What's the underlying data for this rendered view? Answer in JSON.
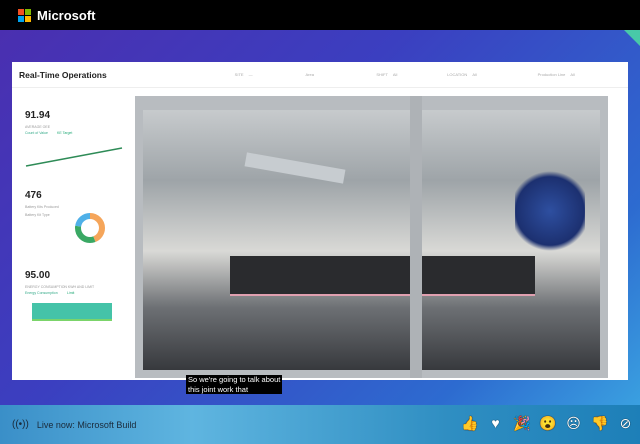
{
  "brand": "Microsoft",
  "dashboard": {
    "title": "Real-Time Operations",
    "filters": [
      {
        "label": "SITE",
        "value": "—"
      },
      {
        "label": "Area",
        "value": ""
      },
      {
        "label": "SHIFT",
        "value": "All"
      },
      {
        "label": "LOCATION",
        "value": "All"
      },
      {
        "label": "Production Line",
        "value": "All"
      }
    ],
    "kpi1": {
      "value": "91.94",
      "label": "AVERAGE OEE",
      "legend": [
        "Count of Value",
        "KE Target"
      ]
    },
    "kpi2": {
      "value": "476",
      "label": "Battery Kits Produced",
      "legend_title": "Battery Kit Type"
    },
    "kpi3": {
      "value": "95.00",
      "label": "ENERGY CONSUMPTION KWH AND LIMIT",
      "legend": [
        "Energy Consumption",
        "Limit"
      ]
    }
  },
  "caption": [
    "So we're going to talk about",
    "this joint work that"
  ],
  "bottom": {
    "live_label": "Live now:",
    "event": "Microsoft Build"
  },
  "reactions": [
    "like",
    "heart",
    "celebrate",
    "surprised",
    "sad",
    "dislike",
    "disable-reactions"
  ],
  "colors": {
    "accent_green": "#2e8b57",
    "donut_orange": "#f5a55a",
    "donut_green": "#3aa864",
    "donut_blue": "#4fb0e8",
    "energy": "#45c3a8"
  }
}
